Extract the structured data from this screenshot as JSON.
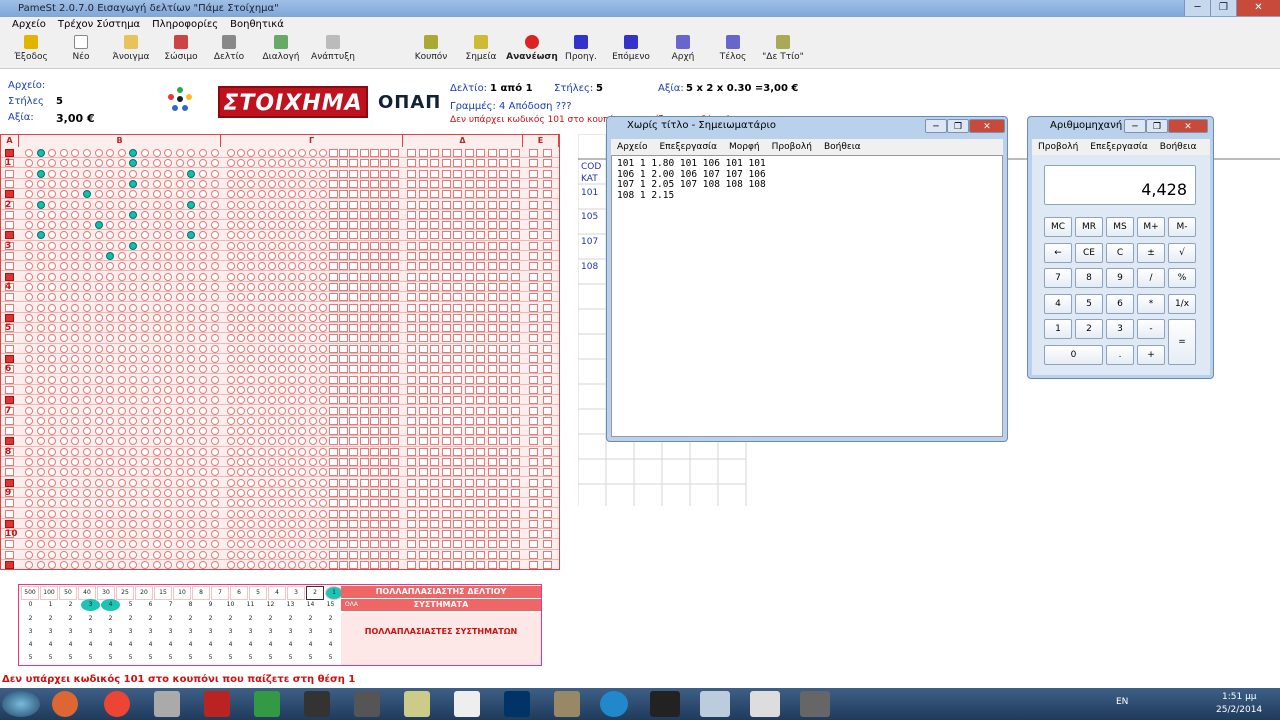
{
  "app": {
    "title": "PameSt 2.0.7.0  Εισαγωγή δελτίων \"Πάμε Στοίχημα\""
  },
  "menu": [
    "Αρχείο",
    "Τρέχον Σύστημα",
    "Πληροφορίες",
    "Βοηθητικά"
  ],
  "toolbar": [
    "Έξοδος",
    "Νέο",
    "Άνοιγμα",
    "Σώσιμο",
    "Δελτίο",
    "Διαλογή",
    "Ανάπτυξη",
    "Κουπόν",
    "Σημεία",
    "Ανανέωση",
    "Προηγ.",
    "Επόμενο",
    "Αρχή",
    "Τέλος",
    "\"Δε Ττίο\""
  ],
  "info": {
    "archive_label": "Αρχείο:",
    "rows_label": "Στήλες",
    "rows_value": "5",
    "value_label": "Αξία:",
    "value_value": "3,00 €",
    "ticket_label": "Δελτίο:",
    "ticket_value": "1 από 1",
    "cols_label": "Στήλες:",
    "cols_value": "5",
    "worth_label": "Αξία:",
    "worth_value": "5 x 2 x 0.30 =3,00 €",
    "lines_text": "Γραμμές: 4 Απόδοση ???",
    "warn_text": "Δεν υπάρχει κωδικός 101 στο κουπόνι που παίζετε στη θέση 1"
  },
  "logos": {
    "stoixima": "ΣΤΟΙΧΗΜΑ",
    "opap": "ΟΠΑΠ"
  },
  "sheet_headers": [
    "Α",
    "Β",
    "Γ",
    "Δ",
    "Ε"
  ],
  "row_numbers": [
    "1",
    "2",
    "3",
    "4",
    "5",
    "6",
    "7",
    "8",
    "9",
    "10"
  ],
  "mult": {
    "title": "ΠΟΛΛΑΠΛΑΣΙΑΣΤΗΣ ΔΕΛΤΙΟΥ",
    "systems": "ΣΥΣΤΗΜΑΤΑ",
    "label2": "ΠΟΛΛΑΠΛΑΣΙΑΣΤΕΣ ΣΥΣΤΗΜΑΤΩΝ",
    "ola": "ΟΛΑ",
    "topvals": [
      "500",
      "100",
      "50",
      "40",
      "30",
      "25",
      "20",
      "15",
      "10",
      "8",
      "7",
      "6",
      "5",
      "4",
      "3",
      "2",
      "1"
    ],
    "nums": [
      "0",
      "1",
      "2",
      "3",
      "4",
      "5",
      "6",
      "7",
      "8",
      "9",
      "10",
      "11",
      "12",
      "13",
      "14",
      "15"
    ]
  },
  "side_labels": {
    "cod": "COD",
    "kat": "KAT",
    "codes": [
      "101",
      "105",
      "107",
      "108"
    ]
  },
  "status": "Δεν υπάρχει κωδικός 101 στο κουπόνι που παίζετε στη θέση 1",
  "notepad": {
    "title": "Χωρίς τίτλο - Σημειωματάριο",
    "menu": [
      "Αρχείο",
      "Επεξεργασία",
      "Μορφή",
      "Προβολή",
      "Βοήθεια"
    ],
    "text": "101 1 1.80 101 106 101 101\n106 1 2.00 106 107 107 106\n107 1 2.05 107 108 108 108\n108 1 2.15"
  },
  "calc": {
    "title": "Αριθμομηχανή",
    "menu": [
      "Προβολή",
      "Επεξεργασία",
      "Βοήθεια"
    ],
    "display": "4,428",
    "keys": [
      "MC",
      "MR",
      "MS",
      "M+",
      "M-",
      "←",
      "CE",
      "C",
      "±",
      "√",
      "7",
      "8",
      "9",
      "/",
      "%",
      "4",
      "5",
      "6",
      "*",
      "1/x",
      "1",
      "2",
      "3",
      "-",
      "=",
      "0",
      ".",
      "+"
    ]
  },
  "tray": {
    "lang": "EN",
    "time": "1:51 μμ",
    "date": "25/2/2014"
  }
}
